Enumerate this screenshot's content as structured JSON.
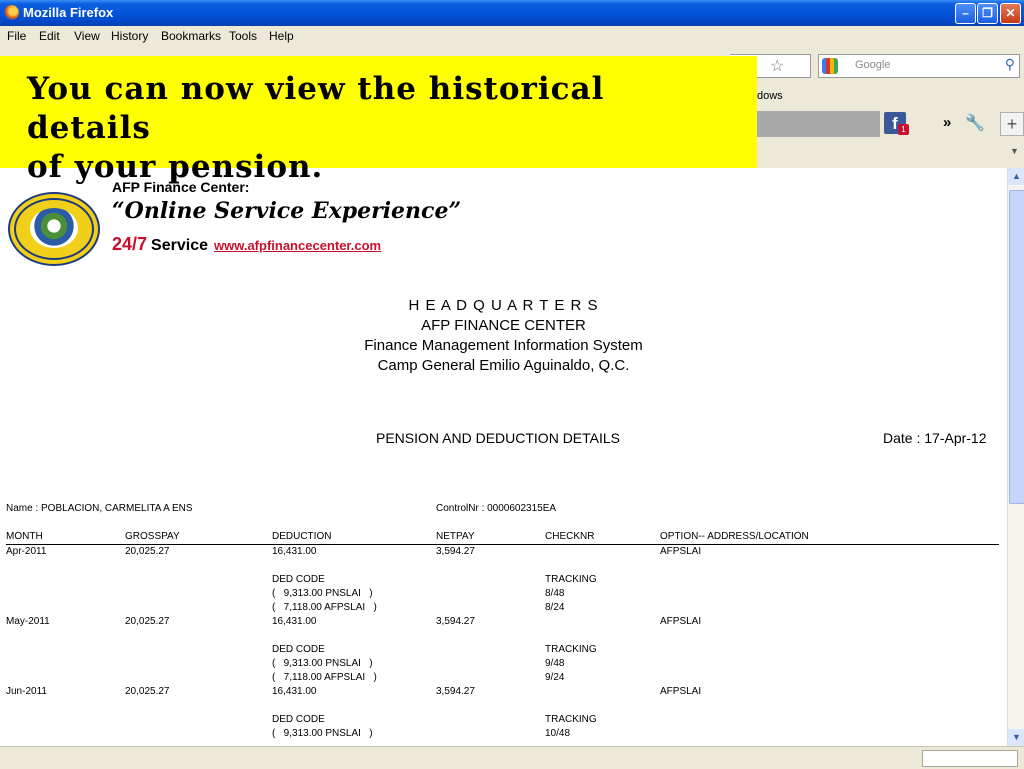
{
  "window": {
    "title": "Mozilla Firefox"
  },
  "menu": [
    "File",
    "Edit",
    "View",
    "History",
    "Bookmarks",
    "Tools",
    "Help"
  ],
  "toolbar": {
    "search_placeholder": "Google",
    "bookmark_fragment": "dows"
  },
  "facebook": {
    "badge": "1"
  },
  "overlay": {
    "message_line1": "You can now view the historical details",
    "message_line2": "of your pension."
  },
  "branding": {
    "line1": "AFP Finance Center:",
    "line2": "“Online Service Experience”",
    "line3_a": "24/7",
    "line3_b": "Service",
    "line3_url": "www.afpfinancecenter.com"
  },
  "header": {
    "hq": "H E A D Q U A R T E R S",
    "org": "AFP FINANCE CENTER",
    "system": "Finance Management Information System",
    "location": "Camp General Emilio Aguinaldo, Q.C."
  },
  "doc": {
    "title": "PENSION AND DEDUCTION DETAILS",
    "date": "Date : 17-Apr-12"
  },
  "person": {
    "name": "Name : POBLACION, CARMELITA A ENS",
    "control": "ControlNr : 0000602315EA"
  },
  "columns": [
    "MONTH",
    "GROSSPAY",
    "DEDUCTION",
    "NETPAY",
    "CHECKNR",
    "OPTION-- ADDRESS/LOCATION"
  ],
  "records": [
    {
      "month": "Apr-2011",
      "gross": "20,025.27",
      "deduction": "16,431.00",
      "net": "3,594.27",
      "option": "AFPSLAI",
      "ded_code": "DED CODE",
      "ded1": "(   9,313.00 PNSLAI   )",
      "ded2": "(   7,118.00 AFPSLAI   )",
      "tracking": "TRACKING",
      "track1": "8/48",
      "track2": "8/24"
    },
    {
      "month": "May-2011",
      "gross": "20,025.27",
      "deduction": "16,431.00",
      "net": "3,594.27",
      "option": "AFPSLAI",
      "ded_code": "DED CODE",
      "ded1": "(   9,313.00 PNSLAI   )",
      "ded2": "(   7,118.00 AFPSLAI   )",
      "tracking": "TRACKING",
      "track1": "9/48",
      "track2": "9/24"
    },
    {
      "month": "Jun-2011",
      "gross": "20,025.27",
      "deduction": "16,431.00",
      "net": "3,594.27",
      "option": "AFPSLAI",
      "ded_code": "DED CODE",
      "ded1": "(   9,313.00 PNSLAI   )",
      "ded2": "",
      "tracking": "TRACKING",
      "track1": "10/48",
      "track2": ""
    }
  ]
}
